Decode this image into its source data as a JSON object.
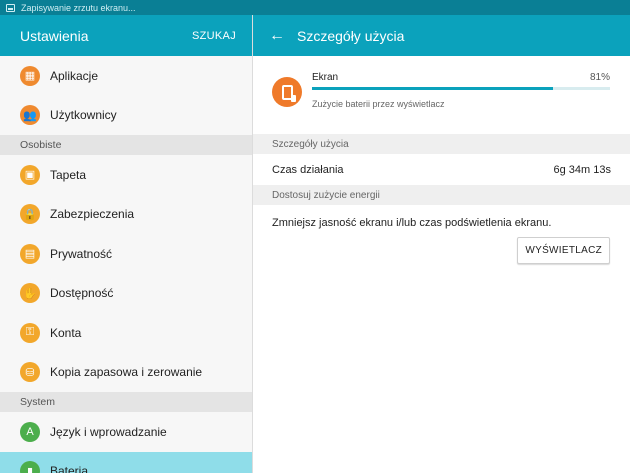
{
  "status_bar": {
    "notification": "Zapisywanie zrzutu ekranu..."
  },
  "settings_panel": {
    "title": "Ustawienia",
    "search_label": "SZUKAJ",
    "items_top": [
      {
        "label": "Aplikacje",
        "icon": "apps-icon"
      },
      {
        "label": "Użytkownicy",
        "icon": "users-icon"
      }
    ],
    "section_personal": "Osobiste",
    "items_personal": [
      {
        "label": "Tapeta",
        "icon": "wallpaper-icon"
      },
      {
        "label": "Zabezpieczenia",
        "icon": "lock-icon"
      },
      {
        "label": "Prywatność",
        "icon": "privacy-icon"
      },
      {
        "label": "Dostępność",
        "icon": "accessibility-hand-icon"
      },
      {
        "label": "Konta",
        "icon": "key-icon"
      },
      {
        "label": "Kopia zapasowa i zerowanie",
        "icon": "backup-icon"
      }
    ],
    "section_system": "System",
    "items_system": [
      {
        "label": "Język i wprowadzanie",
        "icon": "language-icon"
      },
      {
        "label": "Bateria",
        "icon": "battery-icon"
      }
    ]
  },
  "detail_panel": {
    "title": "Szczegóły użycia",
    "usage": {
      "label": "Ekran",
      "percent_text": "81%",
      "percent": 81,
      "subtitle": "Zużycie baterii przez wyświetlacz"
    },
    "section_usage_details": "Szczegóły użycia",
    "runtime_label": "Czas działania",
    "runtime_value": "6g 34m 13s",
    "section_adjust": "Dostosuj zużycie energii",
    "adjust_text": "Zmniejsz jasność ekranu i/lub czas podświetlenia ekranu.",
    "display_button": "WYŚWIETLACZ"
  },
  "colors": {
    "accent": "#0ba2bc",
    "status_bar": "#0a7f95",
    "selected": "#8fdde9",
    "icon_orange": "#ef8a2f",
    "icon_yellow": "#f2a72b",
    "icon_green": "#4cae4c"
  }
}
